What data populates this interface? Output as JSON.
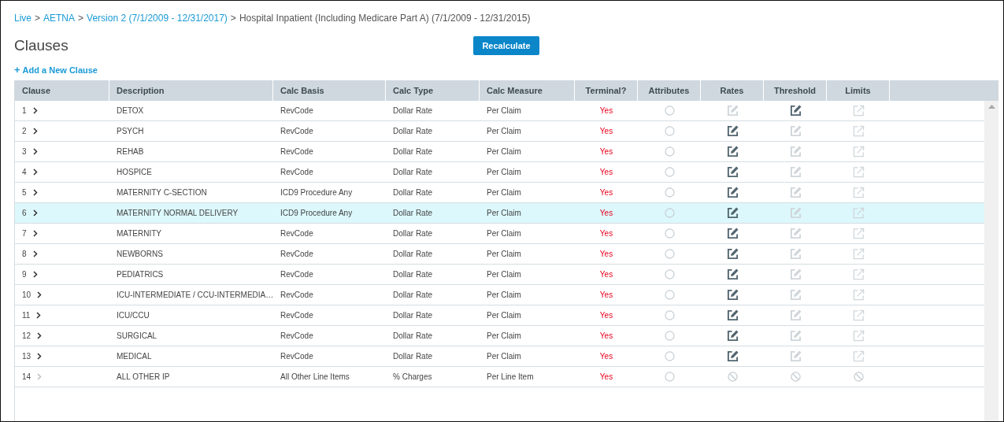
{
  "breadcrumb": {
    "links": [
      "Live",
      "AETNA",
      "Version 2 (7/1/2009 - 12/31/2017)"
    ],
    "separator": ">",
    "current": "Hospital Inpatient (Including Medicare Part A) (7/1/2009 - 12/31/2015)"
  },
  "title": "Clauses",
  "recalculate_button": "Recalculate",
  "add_link": {
    "icon": "+",
    "label": "Add a New Clause"
  },
  "table": {
    "columns": [
      "Clause",
      "Description",
      "Calc Basis",
      "Calc Type",
      "Calc Measure",
      "Terminal?",
      "Attributes",
      "Rates",
      "Threshold",
      "Limits"
    ],
    "rows": [
      {
        "clause": "1",
        "expandable": true,
        "description": "DETOX",
        "calc_basis": "RevCode",
        "calc_type": "Dollar Rate",
        "calc_measure": "Per Claim",
        "terminal": "Yes",
        "selected": false,
        "rates": {
          "kind": "edit",
          "disabled": true
        },
        "threshold": {
          "kind": "edit",
          "disabled": false
        },
        "limits": {
          "kind": "link",
          "disabled": true
        }
      },
      {
        "clause": "2",
        "expandable": true,
        "description": "PSYCH",
        "calc_basis": "RevCode",
        "calc_type": "Dollar Rate",
        "calc_measure": "Per Claim",
        "terminal": "Yes",
        "selected": false,
        "rates": {
          "kind": "edit",
          "disabled": false
        },
        "threshold": {
          "kind": "edit",
          "disabled": true
        },
        "limits": {
          "kind": "link",
          "disabled": true
        }
      },
      {
        "clause": "3",
        "expandable": true,
        "description": "REHAB",
        "calc_basis": "RevCode",
        "calc_type": "Dollar Rate",
        "calc_measure": "Per Claim",
        "terminal": "Yes",
        "selected": false,
        "rates": {
          "kind": "edit",
          "disabled": false
        },
        "threshold": {
          "kind": "edit",
          "disabled": true
        },
        "limits": {
          "kind": "link",
          "disabled": true
        }
      },
      {
        "clause": "4",
        "expandable": true,
        "description": "HOSPICE",
        "calc_basis": "RevCode",
        "calc_type": "Dollar Rate",
        "calc_measure": "Per Claim",
        "terminal": "Yes",
        "selected": false,
        "rates": {
          "kind": "edit",
          "disabled": false
        },
        "threshold": {
          "kind": "edit",
          "disabled": true
        },
        "limits": {
          "kind": "link",
          "disabled": true
        }
      },
      {
        "clause": "5",
        "expandable": true,
        "description": "MATERNITY C-SECTION",
        "calc_basis": "ICD9 Procedure Any",
        "calc_type": "Dollar Rate",
        "calc_measure": "Per Claim",
        "terminal": "Yes",
        "selected": false,
        "rates": {
          "kind": "edit",
          "disabled": false
        },
        "threshold": {
          "kind": "edit",
          "disabled": true
        },
        "limits": {
          "kind": "link",
          "disabled": true
        }
      },
      {
        "clause": "6",
        "expandable": true,
        "description": "MATERNITY NORMAL DELIVERY",
        "calc_basis": "ICD9 Procedure Any",
        "calc_type": "Dollar Rate",
        "calc_measure": "Per Claim",
        "terminal": "Yes",
        "selected": true,
        "rates": {
          "kind": "edit",
          "disabled": false
        },
        "threshold": {
          "kind": "edit",
          "disabled": true
        },
        "limits": {
          "kind": "link",
          "disabled": true
        }
      },
      {
        "clause": "7",
        "expandable": true,
        "description": "MATERNITY",
        "calc_basis": "RevCode",
        "calc_type": "Dollar Rate",
        "calc_measure": "Per Claim",
        "terminal": "Yes",
        "selected": false,
        "rates": {
          "kind": "edit",
          "disabled": false
        },
        "threshold": {
          "kind": "edit",
          "disabled": true
        },
        "limits": {
          "kind": "link",
          "disabled": true
        }
      },
      {
        "clause": "8",
        "expandable": true,
        "description": "NEWBORNS",
        "calc_basis": "RevCode",
        "calc_type": "Dollar Rate",
        "calc_measure": "Per Claim",
        "terminal": "Yes",
        "selected": false,
        "rates": {
          "kind": "edit",
          "disabled": false
        },
        "threshold": {
          "kind": "edit",
          "disabled": true
        },
        "limits": {
          "kind": "link",
          "disabled": true
        }
      },
      {
        "clause": "9",
        "expandable": true,
        "description": "PEDIATRICS",
        "calc_basis": "RevCode",
        "calc_type": "Dollar Rate",
        "calc_measure": "Per Claim",
        "terminal": "Yes",
        "selected": false,
        "rates": {
          "kind": "edit",
          "disabled": false
        },
        "threshold": {
          "kind": "edit",
          "disabled": true
        },
        "limits": {
          "kind": "link",
          "disabled": true
        }
      },
      {
        "clause": "10",
        "expandable": true,
        "description": "ICU-INTERMEDIATE / CCU-INTERMEDIA…",
        "calc_basis": "RevCode",
        "calc_type": "Dollar Rate",
        "calc_measure": "Per Claim",
        "terminal": "Yes",
        "selected": false,
        "rates": {
          "kind": "edit",
          "disabled": false
        },
        "threshold": {
          "kind": "edit",
          "disabled": true
        },
        "limits": {
          "kind": "link",
          "disabled": true
        }
      },
      {
        "clause": "11",
        "expandable": true,
        "description": "ICU/CCU",
        "calc_basis": "RevCode",
        "calc_type": "Dollar Rate",
        "calc_measure": "Per Claim",
        "terminal": "Yes",
        "selected": false,
        "rates": {
          "kind": "edit",
          "disabled": false
        },
        "threshold": {
          "kind": "edit",
          "disabled": true
        },
        "limits": {
          "kind": "link",
          "disabled": true
        }
      },
      {
        "clause": "12",
        "expandable": true,
        "description": "SURGICAL",
        "calc_basis": "RevCode",
        "calc_type": "Dollar Rate",
        "calc_measure": "Per Claim",
        "terminal": "Yes",
        "selected": false,
        "rates": {
          "kind": "edit",
          "disabled": false
        },
        "threshold": {
          "kind": "edit",
          "disabled": true
        },
        "limits": {
          "kind": "link",
          "disabled": true
        }
      },
      {
        "clause": "13",
        "expandable": true,
        "description": "MEDICAL",
        "calc_basis": "RevCode",
        "calc_type": "Dollar Rate",
        "calc_measure": "Per Claim",
        "terminal": "Yes",
        "selected": false,
        "rates": {
          "kind": "edit",
          "disabled": false
        },
        "threshold": {
          "kind": "edit",
          "disabled": true
        },
        "limits": {
          "kind": "link",
          "disabled": true
        }
      },
      {
        "clause": "14",
        "expandable": false,
        "description": "ALL OTHER IP",
        "calc_basis": "All Other Line Items",
        "calc_type": "% Charges",
        "calc_measure": "Per Line Item",
        "terminal": "Yes",
        "selected": false,
        "rates": {
          "kind": "blocked"
        },
        "threshold": {
          "kind": "blocked"
        },
        "limits": {
          "kind": "blocked"
        }
      }
    ]
  }
}
